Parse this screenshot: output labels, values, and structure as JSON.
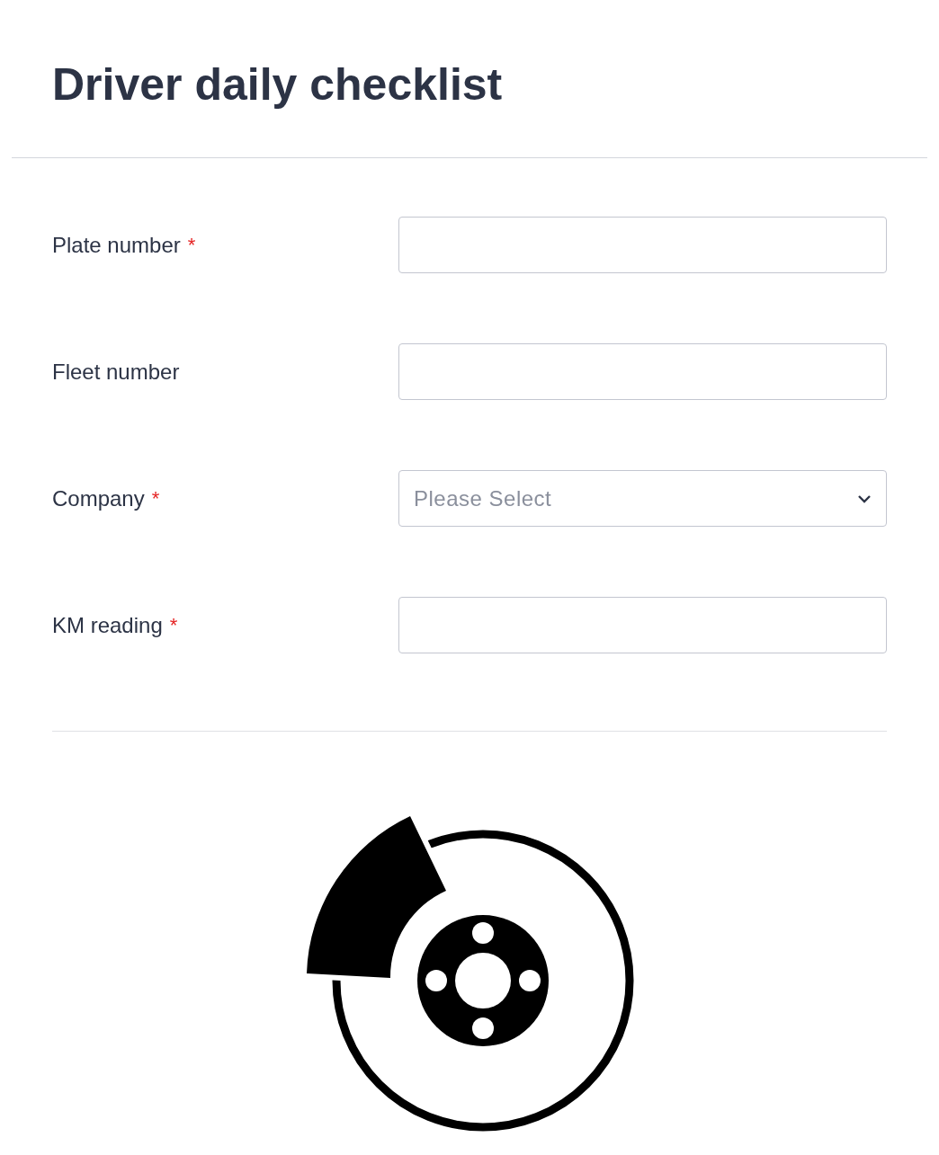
{
  "title": "Driver daily checklist",
  "fields": [
    {
      "label": "Plate number",
      "required_mark": "*",
      "kind": "text"
    },
    {
      "label": "Fleet number",
      "kind": "text"
    },
    {
      "label": "Company",
      "required_mark": "*",
      "kind": "select",
      "placeholder": "Please Select"
    },
    {
      "label": "KM reading",
      "required_mark": "*",
      "kind": "text"
    }
  ]
}
